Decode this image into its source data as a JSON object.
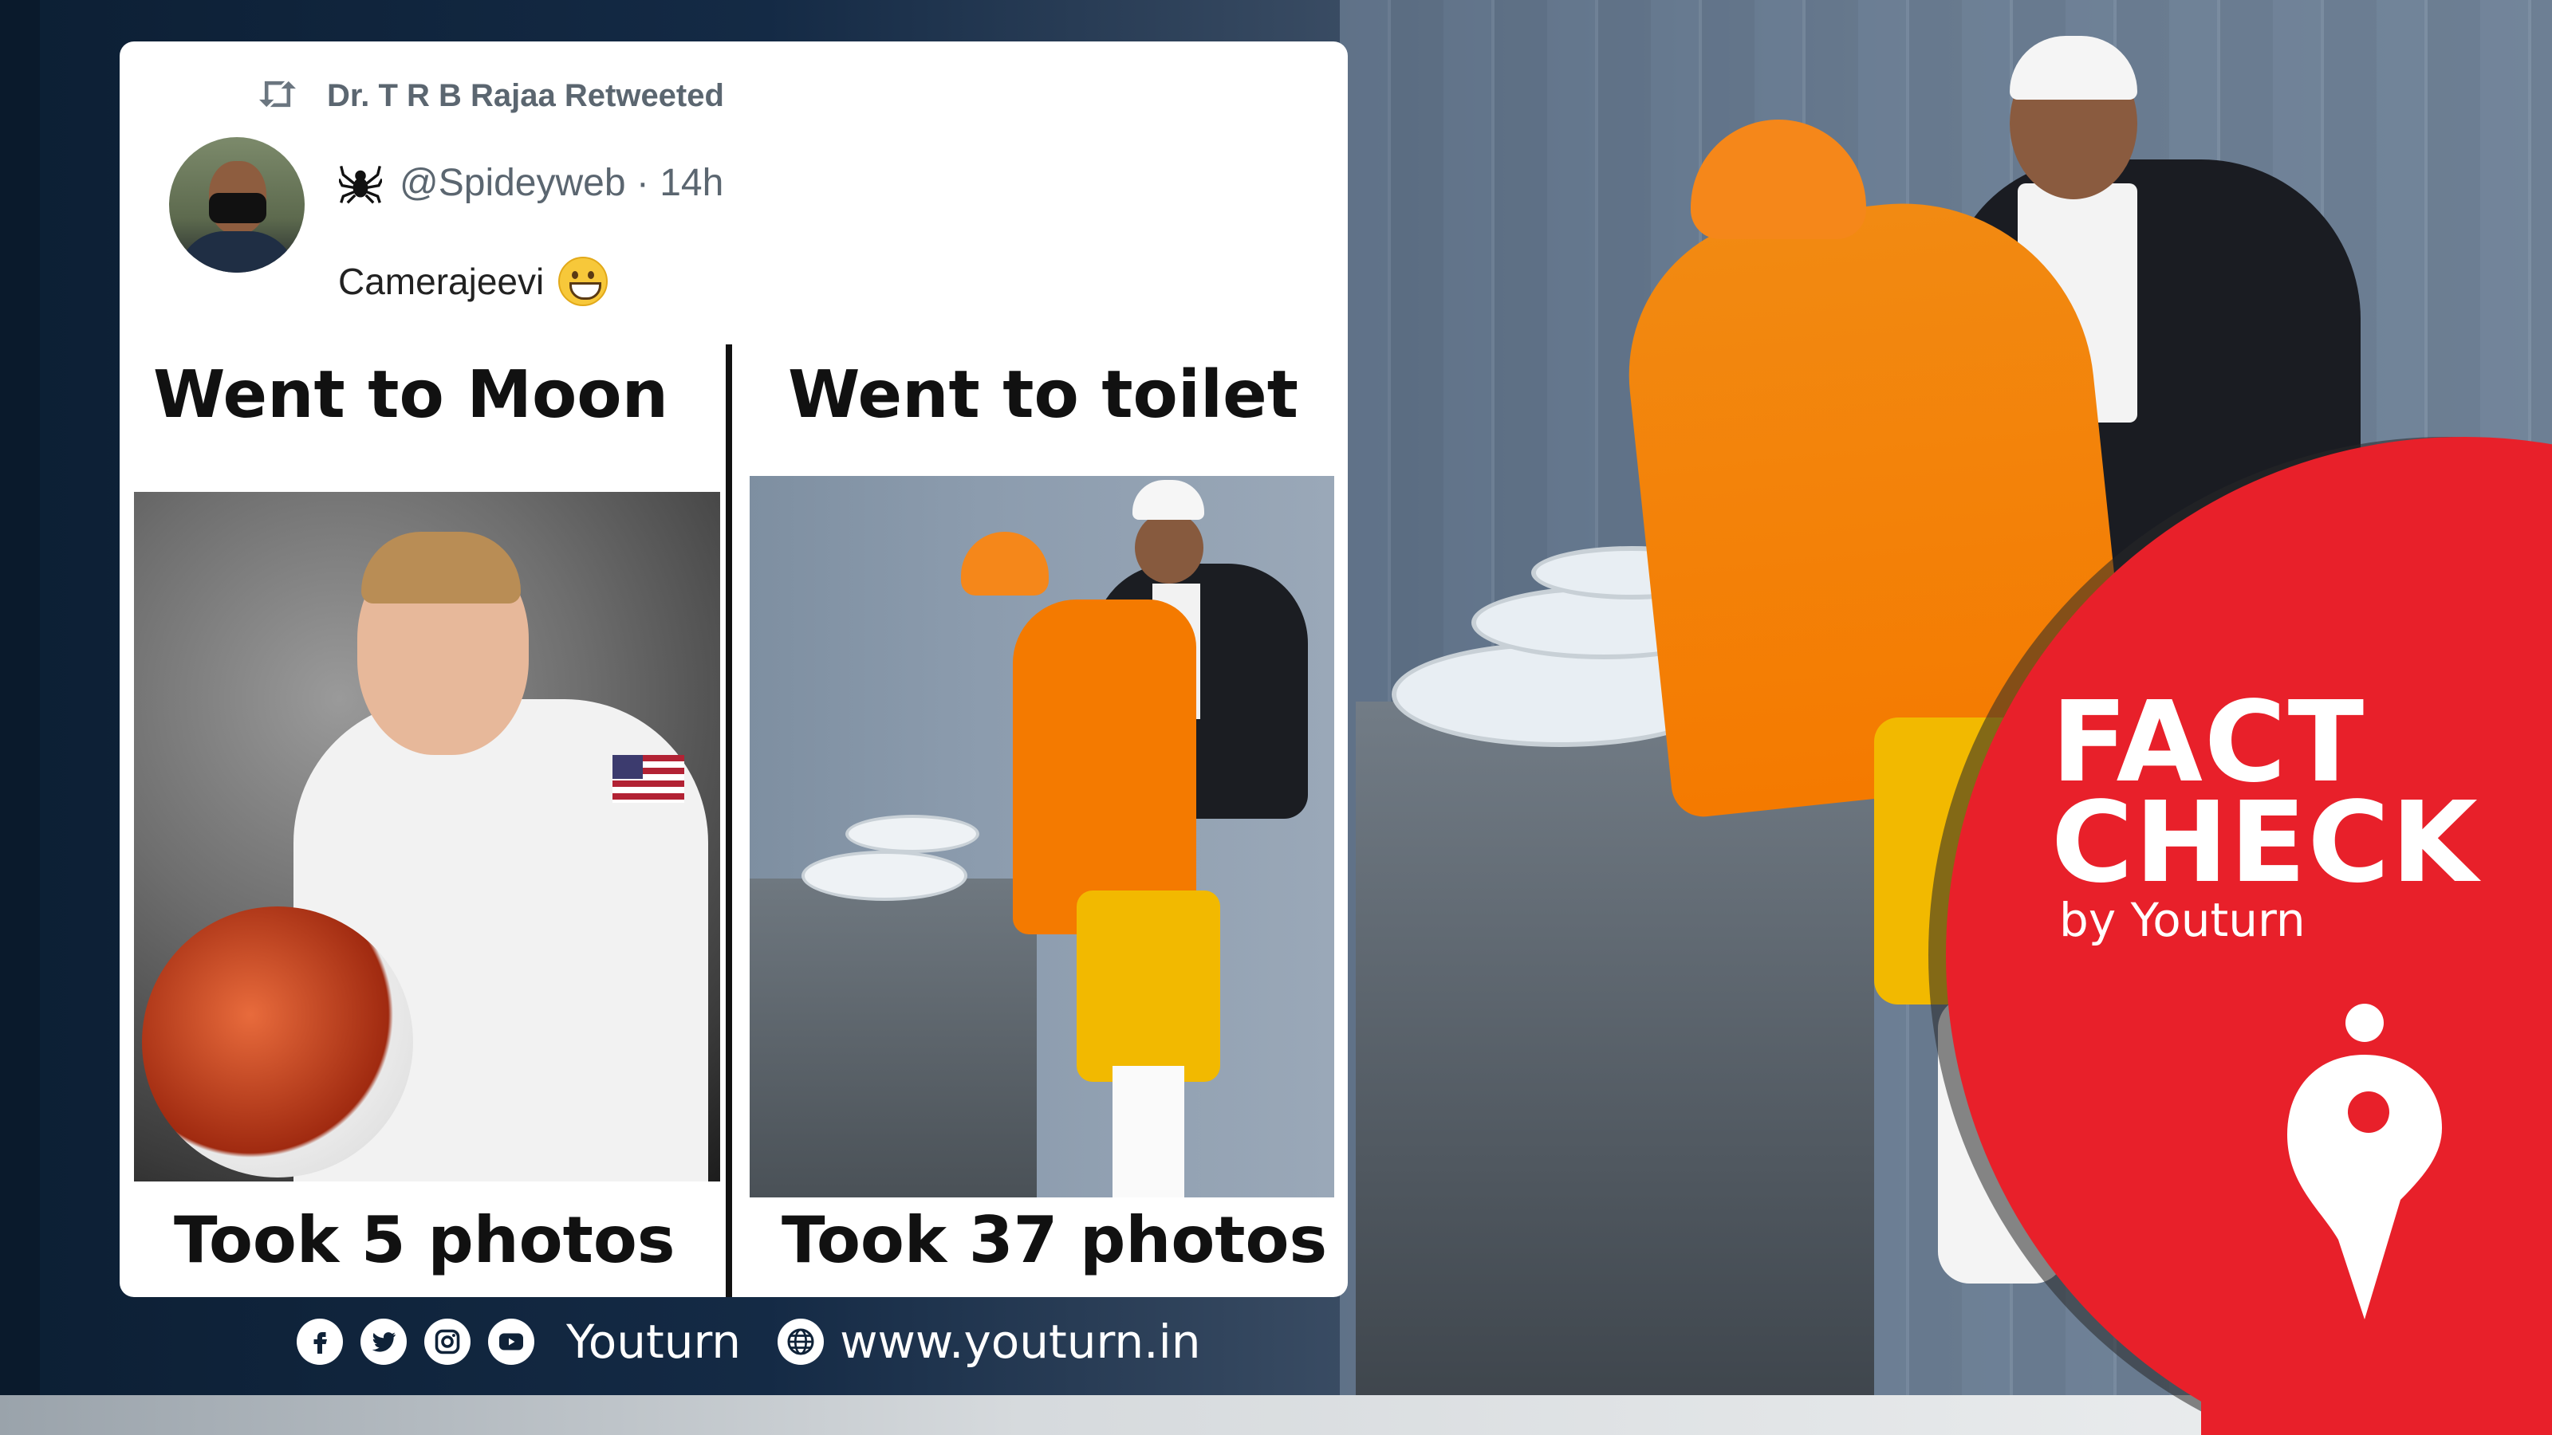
{
  "tweet": {
    "retweeted_by": "Dr. T R B Rajaa Retweeted",
    "handle_line": "@Spideyweb · 14h",
    "text": "Camerajeevi"
  },
  "meme": {
    "left_title": "Went to Moon",
    "right_title": "Went to toilet",
    "left_caption": "Took 5 photos",
    "right_caption": "Took 37 photos"
  },
  "footer": {
    "icons": [
      "facebook-icon",
      "twitter-icon",
      "instagram-icon",
      "youtube-icon"
    ],
    "brand": "Youturn",
    "url": "www.youturn.in"
  },
  "badge": {
    "line1": "FACT",
    "line2": "CHECK",
    "by": "by Youturn"
  },
  "colors": {
    "badge_red": "#e8202a",
    "background_navy": "#0f2238",
    "card_white": "#ffffff",
    "text_grey": "#5b6670"
  }
}
